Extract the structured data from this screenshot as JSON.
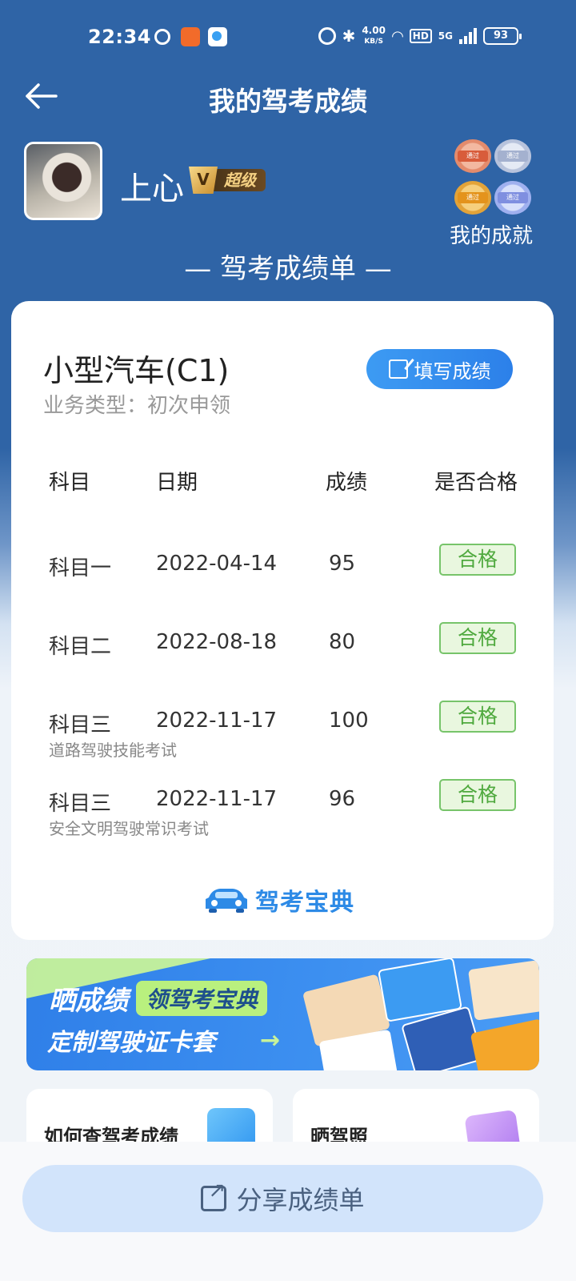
{
  "status_bar": {
    "time": "22:34",
    "net_speed_value": "4.00",
    "net_speed_unit": "KB/S",
    "hd_label": "HD",
    "network_label": "5G",
    "battery": "93"
  },
  "header": {
    "title": "我的驾考成绩",
    "back_icon": "arrow-left-icon"
  },
  "profile": {
    "username": "上心",
    "vip_letter": "V",
    "vip_label": "超级",
    "achievements_label": "我的成就",
    "medal_text": "通过"
  },
  "section_title": "— 驾考成绩单 —",
  "card": {
    "license_type": "小型汽车(C1)",
    "business_type": "业务类型：初次申领",
    "fill_button": "填写成绩",
    "columns": [
      "科目",
      "日期",
      "成绩",
      "是否合格"
    ],
    "rows": [
      {
        "subject": "科目一",
        "date": "2022-04-14",
        "score": "95",
        "result": "合格",
        "note": ""
      },
      {
        "subject": "科目二",
        "date": "2022-08-18",
        "score": "80",
        "result": "合格",
        "note": ""
      },
      {
        "subject": "科目三",
        "date": "2022-11-17",
        "score": "100",
        "result": "合格",
        "note": "道路驾驶技能考试"
      },
      {
        "subject": "科目三",
        "date": "2022-11-17",
        "score": "96",
        "result": "合格",
        "note": "安全文明驾驶常识考试"
      }
    ],
    "brand": "驾考宝典"
  },
  "banner": {
    "line1_main": "晒成绩",
    "line1_pill": "领驾考宝典",
    "line2": "定制驾驶证卡套",
    "arrow": "→"
  },
  "info_cards": [
    {
      "label": "如何查驾考成绩"
    },
    {
      "label": "晒驾照"
    }
  ],
  "share_button": "分享成绩单",
  "colors": {
    "header_blue": "#2f64a6",
    "accent_blue": "#2c80e9",
    "pass_green": "#4fa93e",
    "pass_bg": "#e9f7df"
  }
}
